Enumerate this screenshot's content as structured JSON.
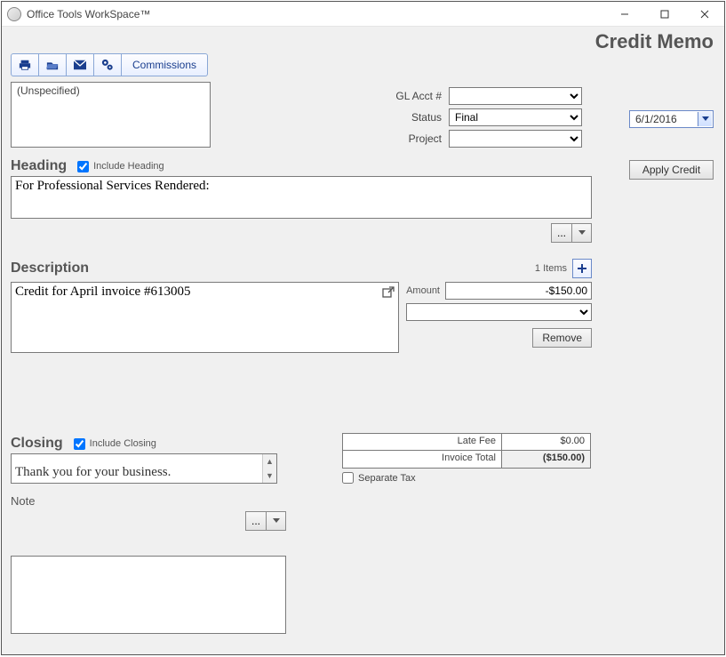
{
  "window": {
    "title": "Office Tools WorkSpace™"
  },
  "page": {
    "title": "Credit Memo"
  },
  "toolbar": {
    "commissions_label": "Commissions"
  },
  "contact_box": {
    "value": "(Unspecified)"
  },
  "fields": {
    "gl_acct": {
      "label": "GL Acct #",
      "value": ""
    },
    "status": {
      "label": "Status",
      "value": "Final",
      "options": [
        "Final"
      ]
    },
    "project": {
      "label": "Project",
      "value": ""
    }
  },
  "date": {
    "value": "6/1/2016"
  },
  "apply_credit_label": "Apply Credit",
  "heading": {
    "section_label": "Heading",
    "include_label": "Include Heading",
    "include_checked": true,
    "text": "For Professional Services Rendered:"
  },
  "description": {
    "section_label": "Description",
    "items_count_label": "1 Items",
    "text": "Credit for April invoice #613005",
    "amount_label": "Amount",
    "amount_value": "-$150.00",
    "category_value": "",
    "remove_label": "Remove"
  },
  "closing": {
    "section_label": "Closing",
    "include_label": "Include Closing",
    "include_checked": true,
    "text": "Thank you for your business."
  },
  "totals": {
    "late_fee_label": "Late Fee",
    "late_fee_value": "$0.00",
    "invoice_total_label": "Invoice Total",
    "invoice_total_value": "($150.00)",
    "separate_tax_label": "Separate Tax",
    "separate_tax_checked": false
  },
  "note": {
    "label": "Note",
    "value": ""
  },
  "misc": {
    "ellipsis": "..."
  }
}
